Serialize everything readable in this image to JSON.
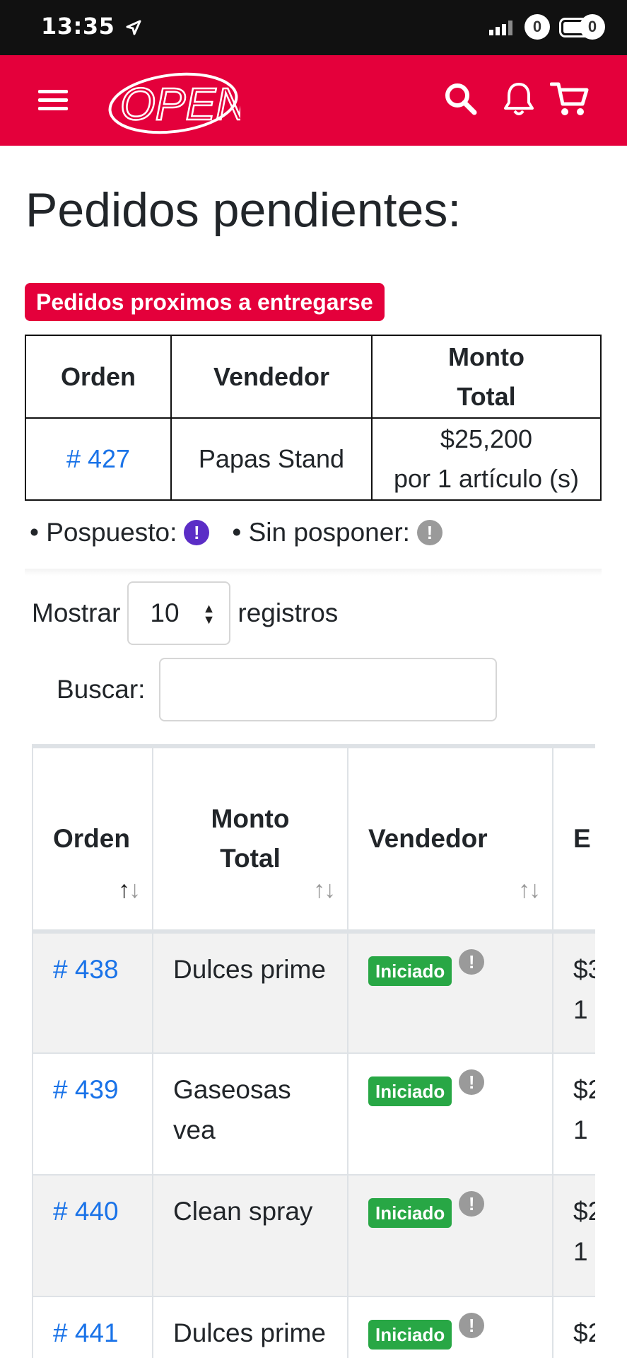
{
  "status_bar": {
    "time": "13:35",
    "network": "4G"
  },
  "navbar": {
    "logo_text": "OPEN",
    "notifications_count": "0",
    "cart_count": "0",
    "brand_color": "#e4003b"
  },
  "page": {
    "title": "Pedidos pendientes:"
  },
  "upcoming": {
    "label": "Pedidos proximos a entregarse",
    "headers": [
      "Orden",
      "Vendedor",
      "Monto",
      "Total"
    ],
    "rows": [
      {
        "order": "# 427",
        "vendor": "Papas Stand",
        "amount": "$25,200",
        "items": "por 1 artículo (s)"
      }
    ]
  },
  "legend": {
    "postponed": "• Pospuesto:",
    "not_postponed": "• Sin posponer:",
    "postponed_color": "#5b2dc6",
    "not_postponed_color": "#9a9a9a"
  },
  "controls": {
    "show_label": "Mostrar",
    "page_size": "10",
    "records_label": "registros",
    "search_label": "Buscar:",
    "search_value": ""
  },
  "orders_table": {
    "headers": {
      "orden": "Orden",
      "monto": "Monto",
      "total": "Total",
      "vendedor": "Vendedor",
      "fourth": "E"
    },
    "status_label": "Iniciado",
    "status_color": "#28a745",
    "rows": [
      {
        "order": "# 438",
        "product": "Dulces prime",
        "amount_partial": "$3",
        "count_partial": "1"
      },
      {
        "order": "# 439",
        "product": "Gaseosas vea",
        "amount_partial": "$2",
        "count_partial": "1"
      },
      {
        "order": "# 440",
        "product": "Clean spray",
        "amount_partial": "$2",
        "count_partial": "1"
      },
      {
        "order": "# 441",
        "product": "Dulces prime",
        "amount_partial": "$2",
        "count_partial": "1"
      }
    ]
  }
}
